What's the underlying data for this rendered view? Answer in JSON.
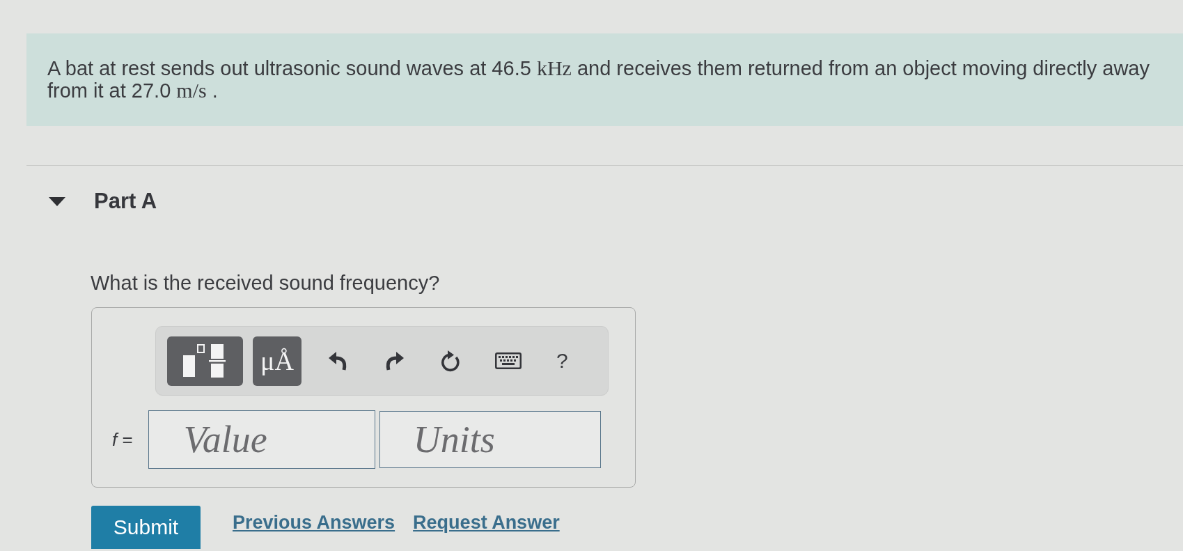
{
  "problem": {
    "segments": [
      {
        "kind": "text",
        "text": "A bat at rest sends out ultrasonic sound waves at 46.5 "
      },
      {
        "kind": "math",
        "text": "kHz"
      },
      {
        "kind": "text",
        "text": " and receives them returned from an object moving directly away from it at 27.0 "
      },
      {
        "kind": "math",
        "text": "m/s"
      },
      {
        "kind": "text",
        "text": " ."
      }
    ]
  },
  "part": {
    "title": "Part A",
    "expanded": true,
    "question": "What is the received sound frequency?",
    "toolbar": [
      {
        "kind": "templates"
      },
      {
        "kind": "units",
        "label": "μÅ"
      },
      {
        "kind": "undo"
      },
      {
        "kind": "redo"
      },
      {
        "kind": "reset"
      },
      {
        "kind": "keyboard"
      },
      {
        "kind": "help",
        "label": "?"
      }
    ],
    "answer": {
      "label": "*f* =",
      "value_field": {
        "placeholder": "Value"
      },
      "units_field": {
        "placeholder": "Units"
      }
    },
    "actions": {
      "submit": "Submit",
      "links": [
        "Previous Answers",
        "Request Answer"
      ]
    }
  }
}
